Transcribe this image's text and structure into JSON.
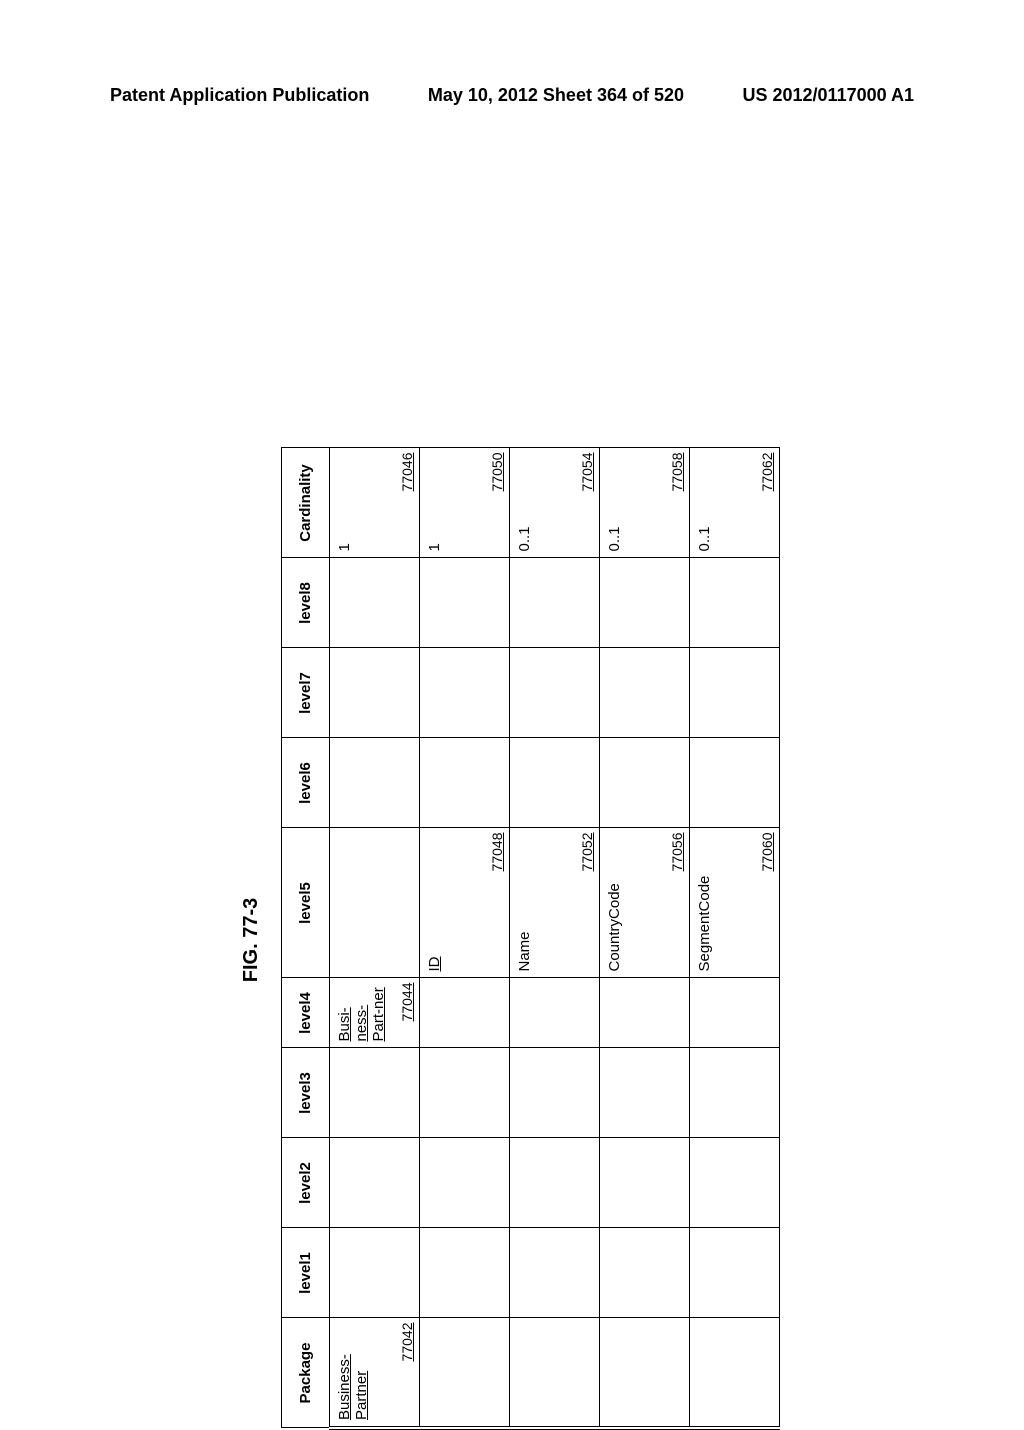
{
  "header": {
    "left": "Patent Application Publication",
    "middle": "May 10, 2012  Sheet 364 of 520",
    "right": "US 2012/0117000 A1"
  },
  "figure_label": "FIG. 77-3",
  "columns": {
    "package": "Package",
    "level1": "level1",
    "level2": "level2",
    "level3": "level3",
    "level4": "level4",
    "level5": "level5",
    "level6": "level6",
    "level7": "level7",
    "level8": "level8",
    "cardinality": "Cardinality"
  },
  "rows": [
    {
      "package": {
        "text": "Business-Partner",
        "ref": "77042"
      },
      "level4": {
        "text": "Busi-ness-Part-ner",
        "ref": "77044"
      },
      "cardinality": {
        "text": "1",
        "ref": "77046"
      }
    },
    {
      "level5": {
        "text": "ID",
        "ref": "77048"
      },
      "cardinality": {
        "text": "1",
        "ref": "77050"
      }
    },
    {
      "level5": {
        "text": "Name",
        "ref": "77052"
      },
      "cardinality": {
        "text": "0..1",
        "ref": "77054"
      }
    },
    {
      "level5": {
        "text": "CountryCode",
        "ref": "77056"
      },
      "cardinality": {
        "text": "0..1",
        "ref": "77058"
      }
    },
    {
      "level5": {
        "text": "SegmentCode",
        "ref": "77060"
      },
      "cardinality": {
        "text": "0..1",
        "ref": "77062"
      }
    }
  ]
}
